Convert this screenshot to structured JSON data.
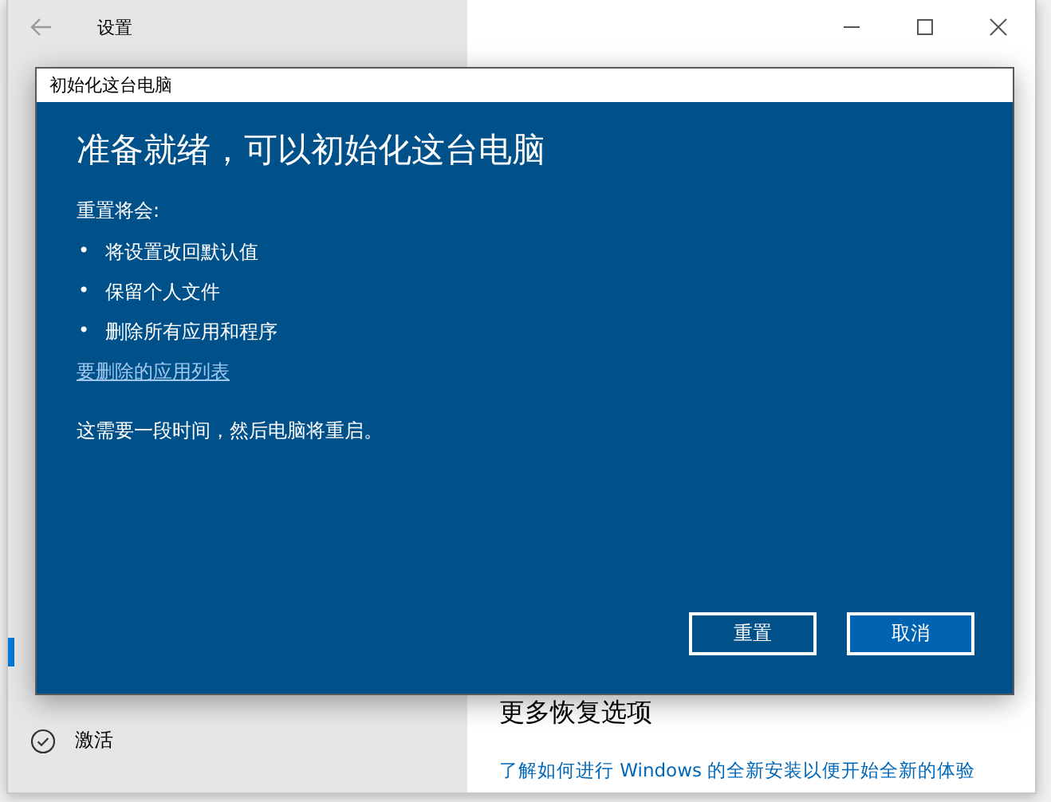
{
  "window": {
    "title": "设置"
  },
  "sidebar": {
    "items": [
      {
        "label": "激活",
        "selected": false
      }
    ]
  },
  "content": {
    "heading": "更多恢复选项",
    "link": "了解如何进行 Windows 的全新安装以便开始全新的体验"
  },
  "dialog": {
    "title": "初始化这台电脑",
    "heading": "准备就绪，可以初始化这台电脑",
    "intro": "重置将会:",
    "items": [
      {
        "bullet": "•",
        "text": "将设置改回默认值"
      },
      {
        "bullet": "•",
        "text": "保留个人文件"
      },
      {
        "bullet": "•",
        "text": "删除所有应用和程序"
      }
    ],
    "link": "要删除的应用列表",
    "note": "这需要一段时间，然后电脑将重启。",
    "buttons": [
      {
        "label": "重置",
        "kind": "secondary"
      },
      {
        "label": "取消",
        "kind": "primary"
      }
    ]
  }
}
